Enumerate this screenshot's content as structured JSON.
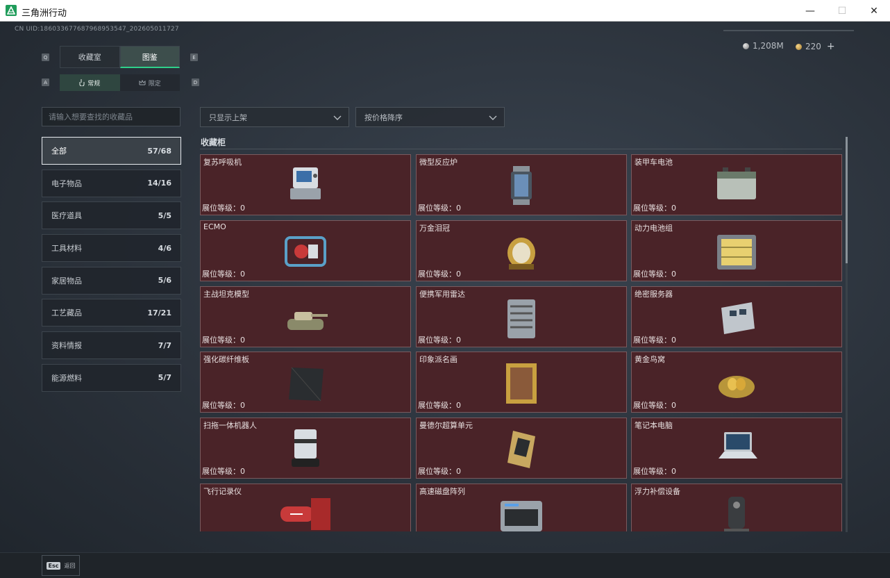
{
  "window": {
    "title": "三角洲行动",
    "minimize": "—",
    "maximize": "☐",
    "close": "✕"
  },
  "uid": "CN UID:1860336776879689535​47_202605011727",
  "currency": {
    "silver": "1,208M",
    "gold": "220",
    "plus": "+"
  },
  "keys": {
    "q": "Q",
    "e": "E",
    "a": "A",
    "d": "D"
  },
  "tabs": [
    {
      "label": "收藏室",
      "active": false
    },
    {
      "label": "图鉴",
      "active": true
    }
  ],
  "subtabs": [
    {
      "label": "常规",
      "active": true
    },
    {
      "label": "限定",
      "active": false
    }
  ],
  "search": {
    "placeholder": "请输入想要查找的收藏品"
  },
  "filters": {
    "shelf": "只显示上架",
    "sort": "按价格降序"
  },
  "categories": [
    {
      "label": "全部",
      "count": "57/68",
      "active": true
    },
    {
      "label": "电子物品",
      "count": "14/16",
      "active": false
    },
    {
      "label": "医疗道具",
      "count": "5/5",
      "active": false
    },
    {
      "label": "工具材料",
      "count": "4/6",
      "active": false
    },
    {
      "label": "家居物品",
      "count": "5/6",
      "active": false
    },
    {
      "label": "工艺藏品",
      "count": "17/21",
      "active": false
    },
    {
      "label": "资料情报",
      "count": "7/7",
      "active": false
    },
    {
      "label": "能源燃料",
      "count": "5/7",
      "active": false
    }
  ],
  "section": {
    "title": "收藏柜"
  },
  "items": [
    {
      "name": "复苏呼吸机",
      "level": "展位等级：0",
      "icon": "ventilator-icon"
    },
    {
      "name": "微型反应炉",
      "level": "展位等级：0",
      "icon": "reactor-icon"
    },
    {
      "name": "装甲车电池",
      "level": "展位等级：0",
      "icon": "battery-icon"
    },
    {
      "name": "ECMO",
      "level": "展位等级：0",
      "icon": "ecmo-icon"
    },
    {
      "name": "万金泪冠",
      "level": "展位等级：0",
      "icon": "crown-egg-icon"
    },
    {
      "name": "动力电池组",
      "level": "展位等级：0",
      "icon": "battery-pack-icon"
    },
    {
      "name": "主战坦克模型",
      "level": "展位等级：0",
      "icon": "tank-icon"
    },
    {
      "name": "便携军用雷达",
      "level": "展位等级：0",
      "icon": "radar-icon"
    },
    {
      "name": "绝密服务器",
      "level": "展位等级：0",
      "icon": "server-icon"
    },
    {
      "name": "强化碳纤维板",
      "level": "展位等级：0",
      "icon": "carbon-plate-icon"
    },
    {
      "name": "印象派名画",
      "level": "展位等级：0",
      "icon": "painting-icon"
    },
    {
      "name": "黄金鸟窝",
      "level": "展位等级：0",
      "icon": "golden-nest-icon"
    },
    {
      "name": "扫拖一体机器人",
      "level": "展位等级：0",
      "icon": "robot-vacuum-icon"
    },
    {
      "name": "曼德尔超算单元",
      "level": "展位等级：0",
      "icon": "compute-unit-icon"
    },
    {
      "name": "笔记本电脑",
      "level": "展位等级：0",
      "icon": "laptop-icon"
    },
    {
      "name": "飞行记录仪",
      "level": "",
      "icon": "flight-recorder-icon"
    },
    {
      "name": "高速磁盘阵列",
      "level": "",
      "icon": "disk-array-icon"
    },
    {
      "name": "浮力补偿设备",
      "level": "",
      "icon": "buoyancy-device-icon"
    }
  ],
  "footer": {
    "esc_key": "Esc",
    "esc_label": "返回"
  },
  "colors": {
    "accent": "#2fd08a",
    "card_bg": "#4a2328",
    "card_border": "#7a5a5e"
  }
}
